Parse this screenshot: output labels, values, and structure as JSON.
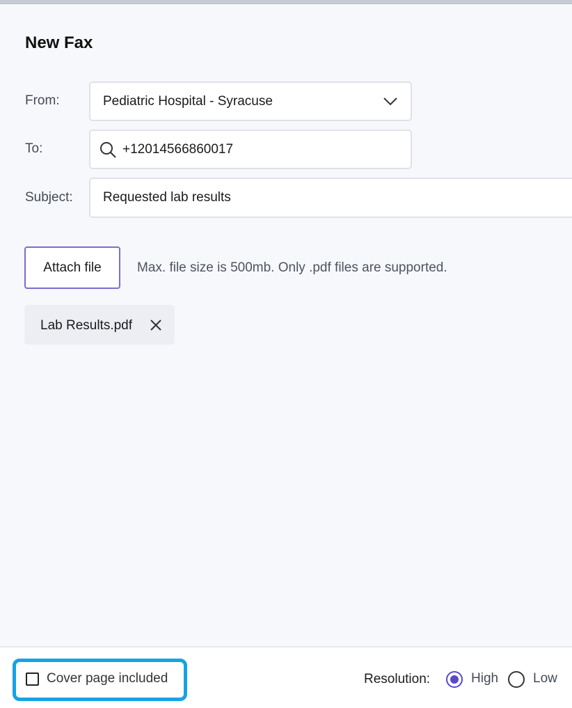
{
  "dialog": {
    "title": "New Fax"
  },
  "form": {
    "from_label": "From:",
    "from_value": "Pediatric Hospital - Syracuse",
    "to_label": "To:",
    "to_value": "+12014566860017",
    "subject_label": "Subject:",
    "subject_value": "Requested lab results"
  },
  "attachments": {
    "attach_button_label": "Attach file",
    "hint": "Max. file size is 500mb. Only .pdf files are supported.",
    "files": [
      {
        "name": "Lab Results.pdf"
      }
    ]
  },
  "footer": {
    "cover_page_label": "Cover page included",
    "cover_page_checked": false,
    "resolution_label": "Resolution:",
    "resolution_options": [
      {
        "label": "High",
        "selected": true
      },
      {
        "label": "Low",
        "selected": false
      }
    ]
  },
  "colors": {
    "accent": "#5a48c9",
    "highlight": "#16a3e3"
  },
  "icons": {
    "from_dropdown": "chevron-down-icon",
    "to_search": "search-icon",
    "file_remove": "close-icon"
  }
}
